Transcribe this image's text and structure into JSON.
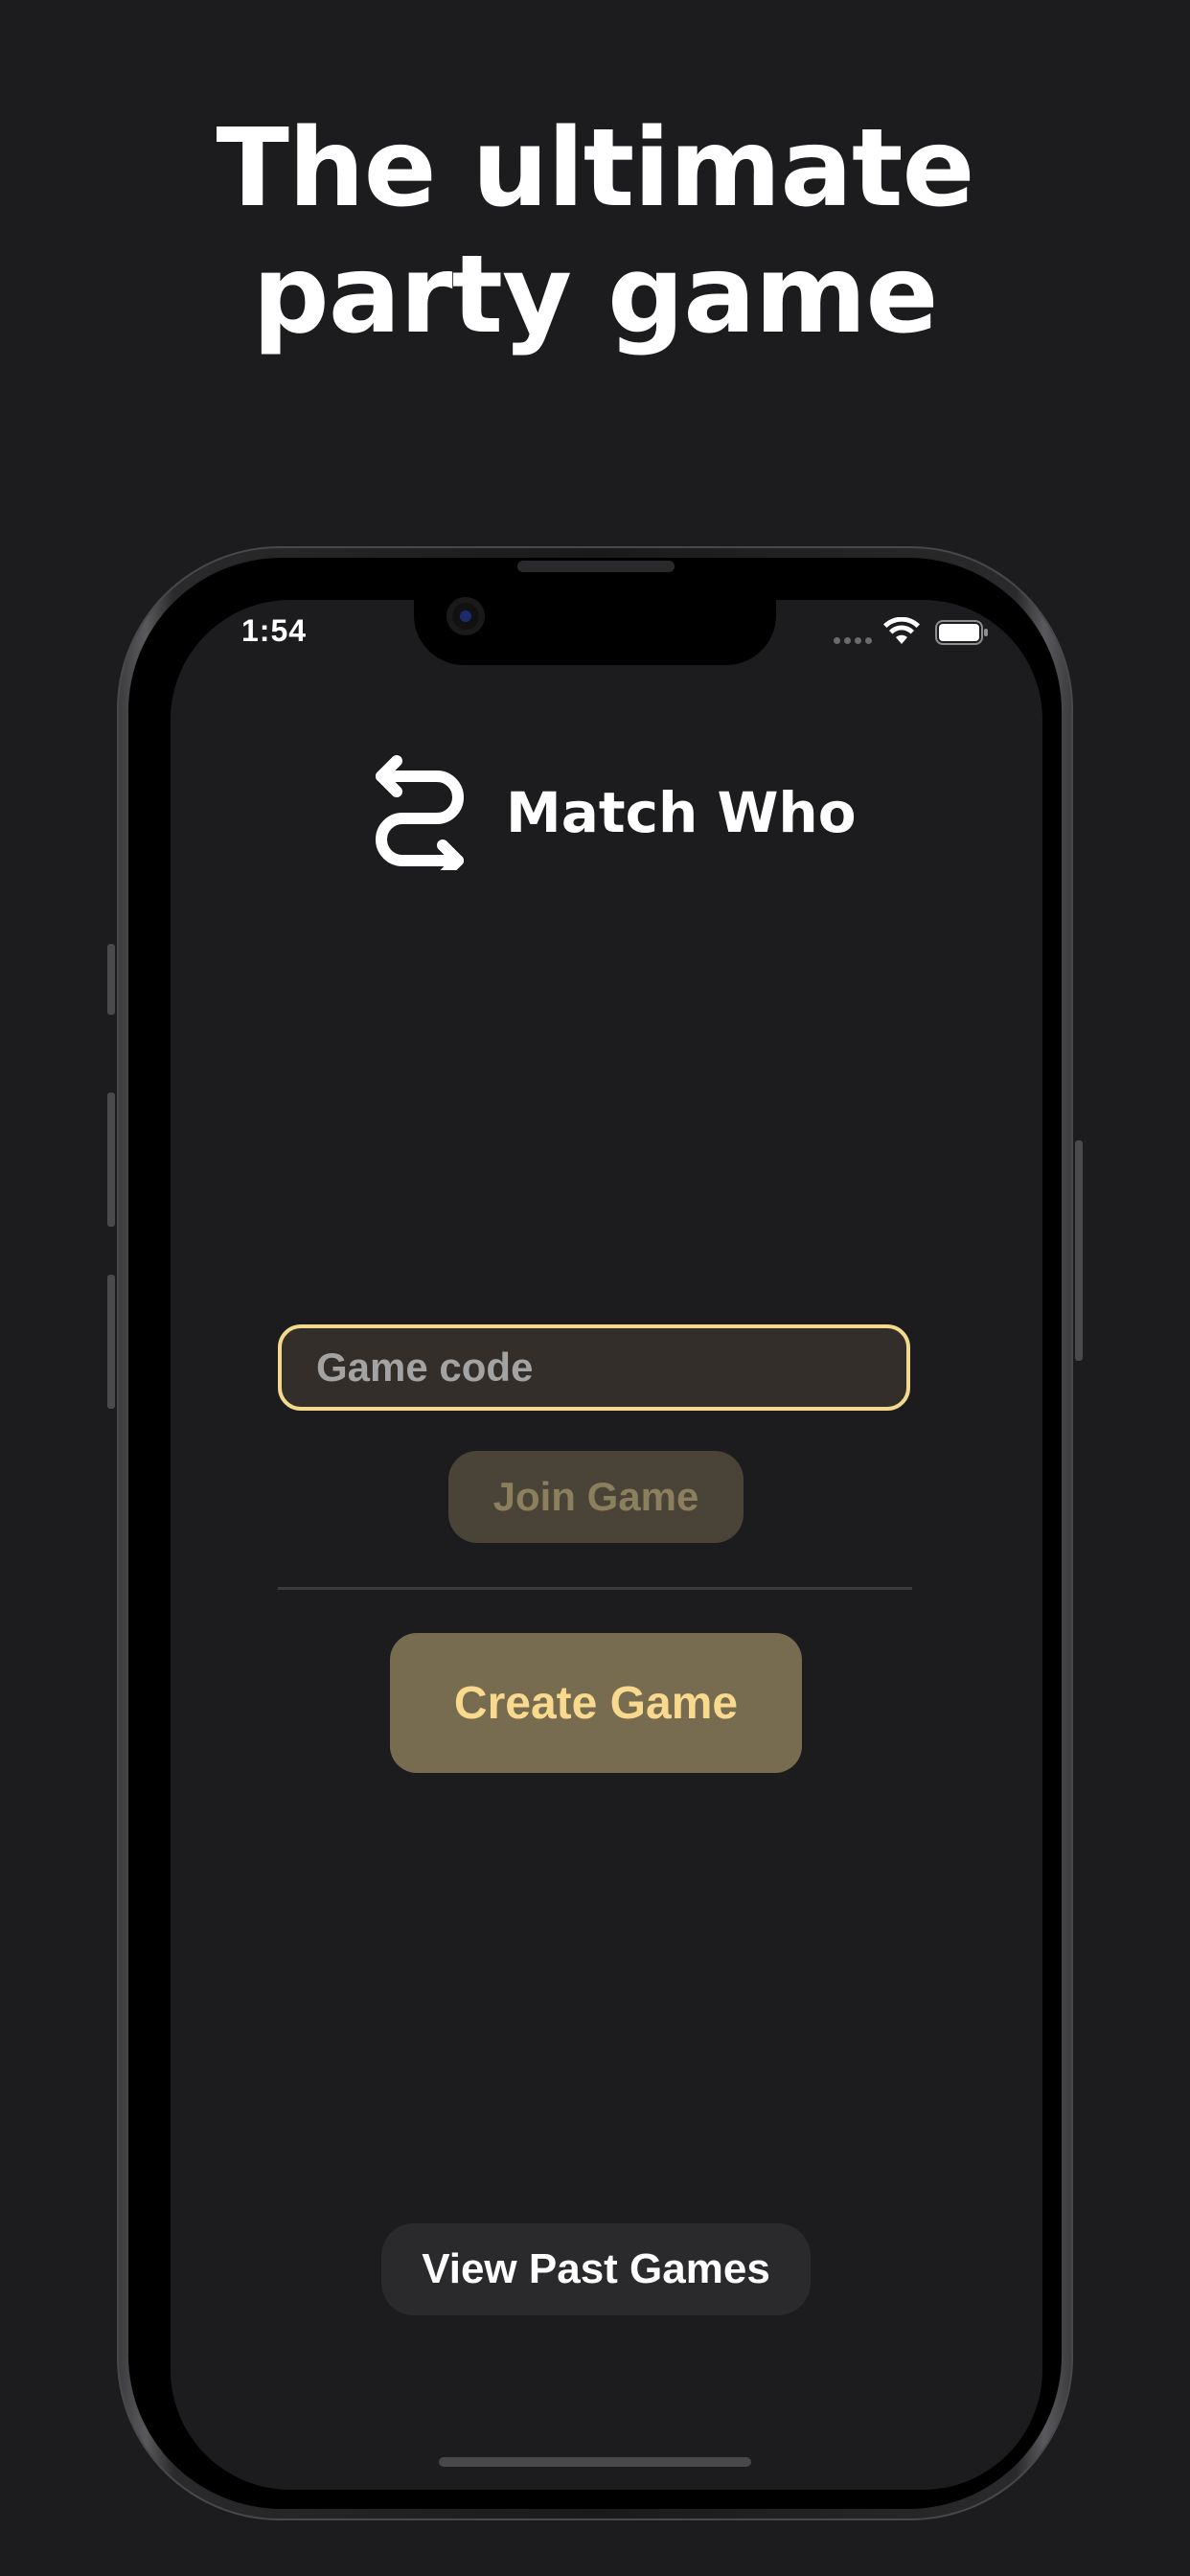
{
  "headline": {
    "line1": "The ultimate",
    "line2": "party game"
  },
  "status_bar": {
    "time": "1:54"
  },
  "app": {
    "name": "Match Who",
    "logo_icon": "swap-arrows-icon"
  },
  "join": {
    "input_value": "",
    "input_placeholder": "Game code",
    "button_label": "Join Game"
  },
  "create": {
    "button_label": "Create Game"
  },
  "history": {
    "button_label": "View Past Games"
  },
  "colors": {
    "background": "#1c1c1e",
    "accent_gold": "#f3d98e",
    "create_button_bg": "#776c50",
    "join_button_bg": "#4a4337",
    "input_bg": "#332e2a"
  }
}
